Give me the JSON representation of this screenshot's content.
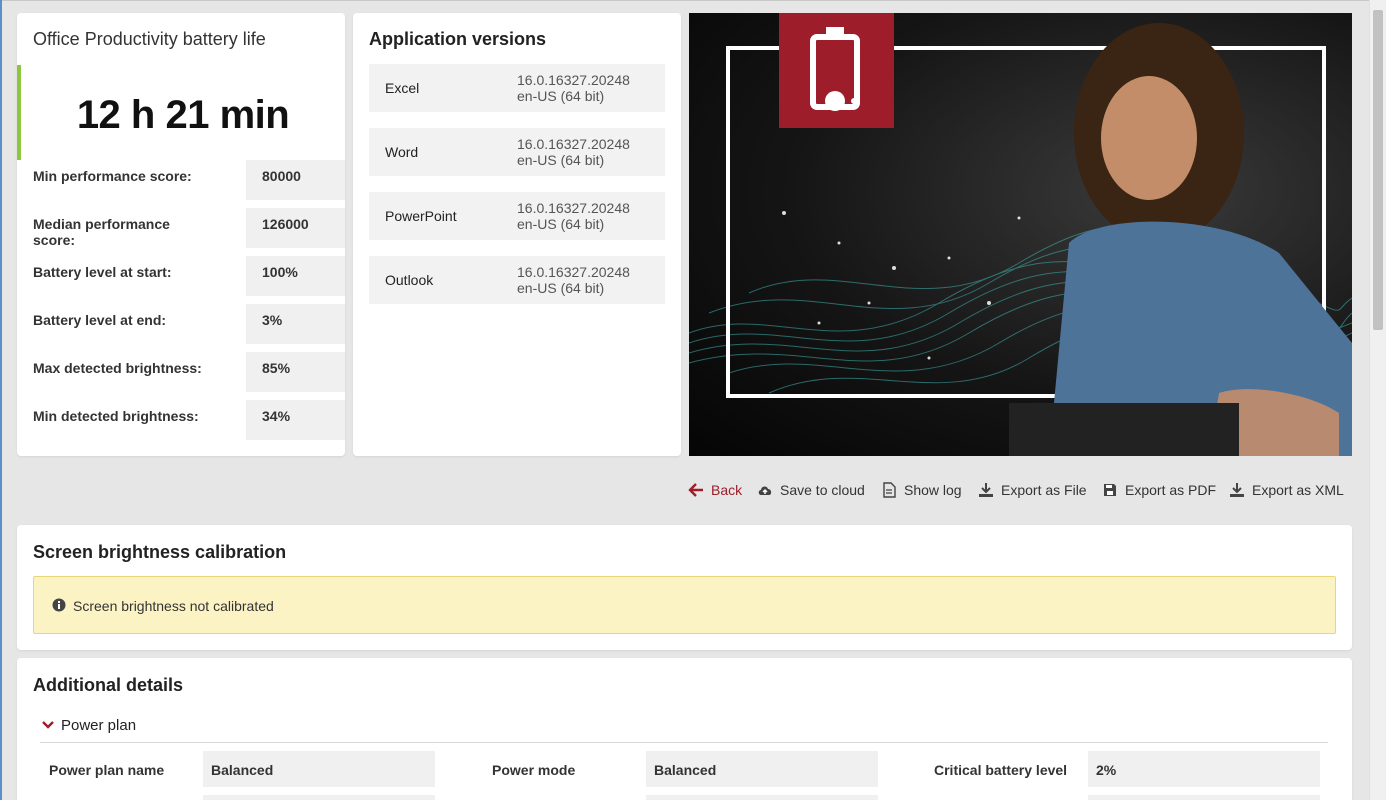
{
  "result": {
    "title": "Office Productivity battery life",
    "score": "12 h 21 min",
    "stats": [
      {
        "label": "Min performance score:",
        "value": "80000"
      },
      {
        "label": "Median performance score:",
        "value": "126000"
      },
      {
        "label": "Battery level at start:",
        "value": "100%"
      },
      {
        "label": "Battery level at end:",
        "value": "3%"
      },
      {
        "label": "Max detected brightness:",
        "value": "85%"
      },
      {
        "label": "Min detected brightness:",
        "value": "34%"
      }
    ]
  },
  "apps": {
    "title": "Application versions",
    "items": [
      {
        "name": "Excel",
        "version": "16.0.16327.20248",
        "locale": "en-US (64 bit)"
      },
      {
        "name": "Word",
        "version": "16.0.16327.20248",
        "locale": "en-US (64 bit)"
      },
      {
        "name": "PowerPoint",
        "version": "16.0.16327.20248",
        "locale": "en-US (64 bit)"
      },
      {
        "name": "Outlook",
        "version": "16.0.16327.20248",
        "locale": "en-US (64 bit)"
      }
    ]
  },
  "hero": {
    "badge_icon": "battery-icon",
    "accent": "#9d1d2a"
  },
  "toolbar": {
    "back": "Back",
    "save_cloud": "Save to cloud",
    "show_log": "Show log",
    "export_file": "Export as File",
    "export_pdf": "Export as PDF",
    "export_xml": "Export as XML"
  },
  "calibration": {
    "title": "Screen brightness calibration",
    "message": "Screen brightness not calibrated",
    "icon": "info-icon"
  },
  "details": {
    "title": "Additional details",
    "section": "Power plan",
    "fields": [
      {
        "label": "Power plan name",
        "value": "Balanced"
      },
      {
        "label": "Power mode",
        "value": "Balanced"
      },
      {
        "label": "Critical battery level",
        "value": "2%"
      }
    ]
  },
  "colors": {
    "accent_green": "#8dc63f",
    "brand_red": "#9d1d2a",
    "warning_bg": "#fcf3c5"
  }
}
